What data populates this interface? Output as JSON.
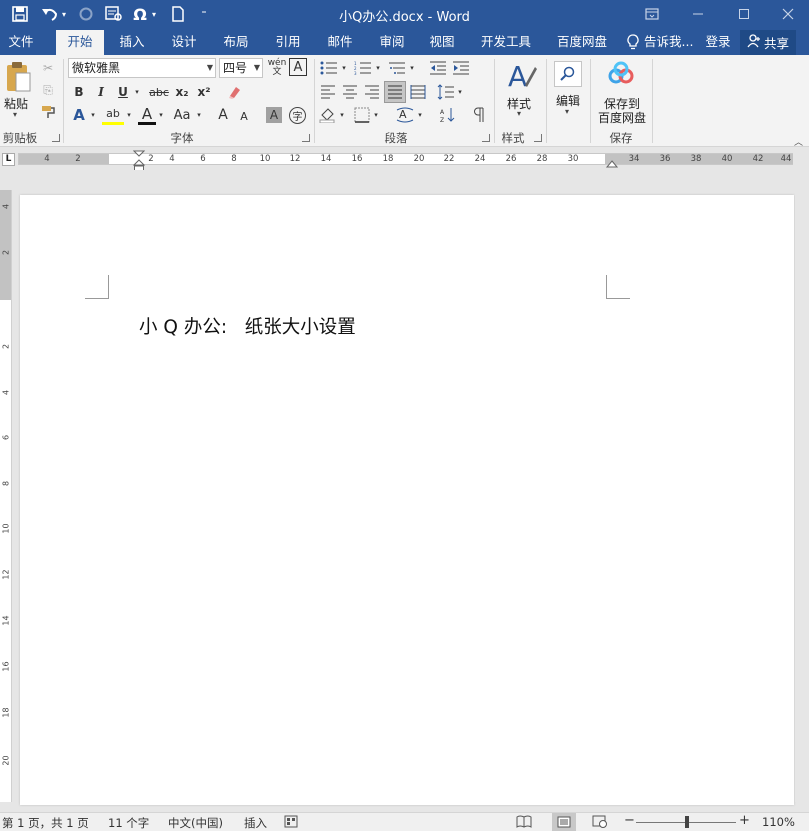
{
  "title_bar": {
    "document_title": "小Q办公.docx - Word",
    "quick_access": [
      {
        "name": "save-icon",
        "glyph": "🖫"
      },
      {
        "name": "undo-icon",
        "glyph": "↶"
      },
      {
        "name": "redo-icon",
        "glyph": "↷"
      },
      {
        "name": "print-preview-icon",
        "glyph": "▦"
      },
      {
        "name": "symbol-icon",
        "glyph": "Ω"
      },
      {
        "name": "new-document-icon",
        "glyph": "▢"
      },
      {
        "name": "customize-icon",
        "glyph": "⁼"
      }
    ],
    "window_controls": [
      {
        "name": "ribbon-display-options-icon",
        "glyph": "▣"
      },
      {
        "name": "minimize-icon",
        "glyph": "—"
      },
      {
        "name": "maximize-icon",
        "glyph": "☐"
      },
      {
        "name": "close-icon",
        "glyph": "✕"
      }
    ]
  },
  "tabs": {
    "items": [
      "文件",
      "开始",
      "插入",
      "设计",
      "布局",
      "引用",
      "邮件",
      "审阅",
      "视图",
      "开发工具",
      "百度网盘"
    ],
    "active": "开始",
    "tell_me": "告诉我...",
    "login": "登录",
    "share": "共享"
  },
  "ribbon": {
    "clipboard": {
      "paste": "粘贴",
      "label": "剪贴板"
    },
    "font": {
      "font_name": "微软雅黑",
      "font_size": "四号",
      "phonetic": "wén",
      "phonetic_sub": "文",
      "char_border": "A",
      "bold": "B",
      "italic": "I",
      "underline": "U",
      "strike": "abc",
      "subscript": "x₂",
      "superscript": "x²",
      "text_effects": "A",
      "highlight": "ab",
      "font_color": "A",
      "change_case": "Aa",
      "grow": "A",
      "shrink": "A",
      "shading": "A",
      "enclose": "字",
      "label": "字体"
    },
    "paragraph": {
      "label": "段落"
    },
    "styles": {
      "button": "样式",
      "label": "样式"
    },
    "editing": {
      "button": "编辑"
    },
    "save": {
      "button_line1": "保存到",
      "button_line2": "百度网盘",
      "label": "保存"
    }
  },
  "ruler": {
    "numbers_left": [
      "4",
      "2"
    ],
    "numbers_main": [
      "2",
      "4",
      "6",
      "8",
      "10",
      "12",
      "14",
      "16",
      "18",
      "20",
      "22",
      "24",
      "26",
      "28",
      "30"
    ],
    "numbers_right": [
      "34",
      "36",
      "38",
      "40",
      "42",
      "44"
    ],
    "corner": "L"
  },
  "vertical_ruler": [
    "4",
    "2",
    "2",
    "4",
    "6",
    "8",
    "10",
    "12",
    "14",
    "16",
    "18",
    "20"
  ],
  "document": {
    "text": "小 Q 办公:   纸张大小设置"
  },
  "status_bar": {
    "page": "第 1 页，共 1 页",
    "words": "11 个字",
    "language": "中文(中国)",
    "mode": "插入",
    "zoom": "110%",
    "zoom_minus": "−",
    "zoom_plus": "+"
  }
}
